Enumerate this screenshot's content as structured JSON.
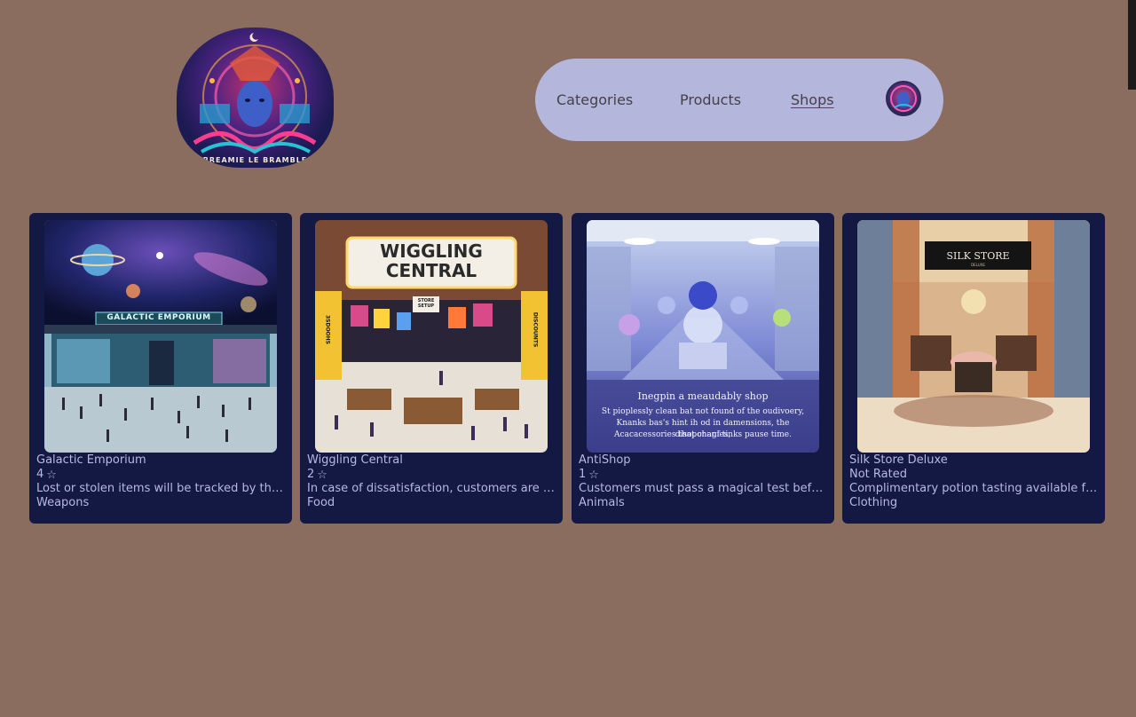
{
  "logo": {
    "text": "BREAMIE LE BRAMBLE"
  },
  "nav": {
    "items": [
      {
        "label": "Categories",
        "active": false
      },
      {
        "label": "Products",
        "active": false
      },
      {
        "label": "Shops",
        "active": true
      }
    ]
  },
  "shops": [
    {
      "name": "Galactic Emporium",
      "rating": "4",
      "rating_icon": "star-icon",
      "description": "Lost or stolen items will be tracked by the shop's intergalactic security team.",
      "category": "Weapons",
      "image_sign": "GALACTIC EMPORIUM"
    },
    {
      "name": "Wiggling Central",
      "rating": "2",
      "rating_icon": "star-icon",
      "description": "In case of dissatisfaction, customers are entitled to a full refund.",
      "category": "Food",
      "image_sign": "WIGGLING CENTRAL",
      "image_side_signs": [
        "STORE SETUP",
        "3SDOOHS",
        "DISCOUNTS"
      ]
    },
    {
      "name": "AntiShop",
      "rating": "1",
      "rating_icon": "star-icon",
      "description": "Customers must pass a magical test before purchasing any item.",
      "category": "Animals",
      "image_caption": [
        "Inegpin a meaudably shop",
        "St pioplessly clean bat not found of the oudivoery,",
        "Knanks bas's hint ih od in damensions, the disoponanies,",
        "Acacacessories that chagf tinks   pause time."
      ]
    },
    {
      "name": "Silk Store Deluxe",
      "rating": "Not Rated",
      "rating_icon": "",
      "description": "Complimentary potion tasting available for all customers.",
      "category": "Clothing",
      "image_sign": "SILK STORE",
      "image_subsign": "DELUXE"
    }
  ],
  "colors": {
    "background": "#8b6d5f",
    "card": "#141944",
    "card_text": "#b6b9e0",
    "nav": "#b4b6dc"
  }
}
